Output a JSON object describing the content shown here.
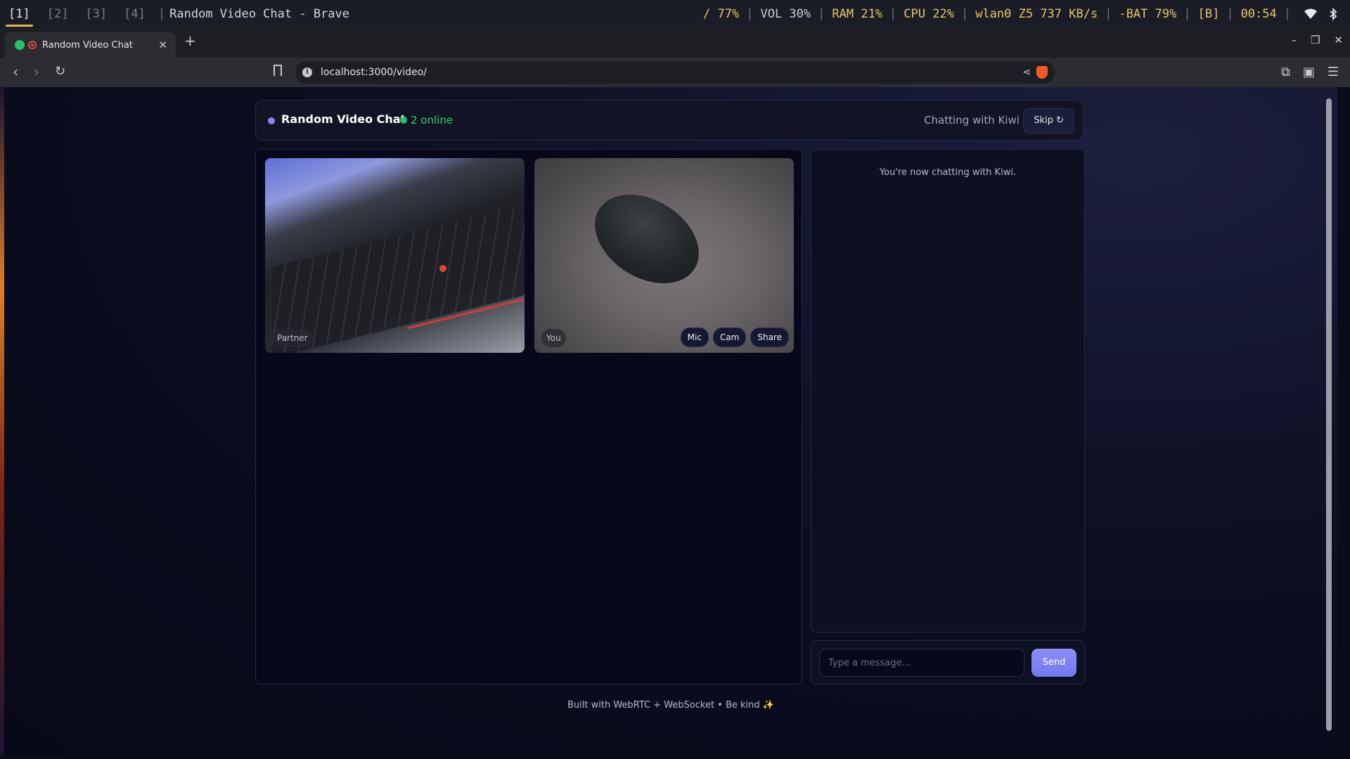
{
  "wm": {
    "workspaces": [
      "[1]",
      "[2]",
      "[3]",
      "[4]"
    ],
    "window_title": "Random Video Chat - Brave",
    "status": {
      "disk": "/ 77%",
      "vol": "VOL 30%",
      "ram": "RAM 21%",
      "cpu": "CPU 22%",
      "net": "wlan0 Z5 737 KB/s",
      "bat": "-BAT 79%",
      "layout": "[B]",
      "clock": "00:54"
    }
  },
  "browser": {
    "tab_title": "Random Video Chat",
    "url": "localhost:3000/video/"
  },
  "header": {
    "title": "Random Video Chat",
    "online": "2 online",
    "chatting_with": "Chatting with Kiwi",
    "skip_label": "Skip ↻"
  },
  "videos": {
    "partner_label": "Partner",
    "you_label": "You",
    "buttons": [
      "Mic",
      "Cam",
      "Share"
    ]
  },
  "chat": {
    "system_message": "You're now chatting with Kiwi.",
    "input_placeholder": "Type a message...",
    "send_label": "Send"
  },
  "footer": {
    "text": "Built with WebRTC + WebSocket • Be kind ✨"
  },
  "colors": {
    "accent": "#7b80f0",
    "online_green": "#22c55e",
    "background": "#0b0c1a"
  }
}
